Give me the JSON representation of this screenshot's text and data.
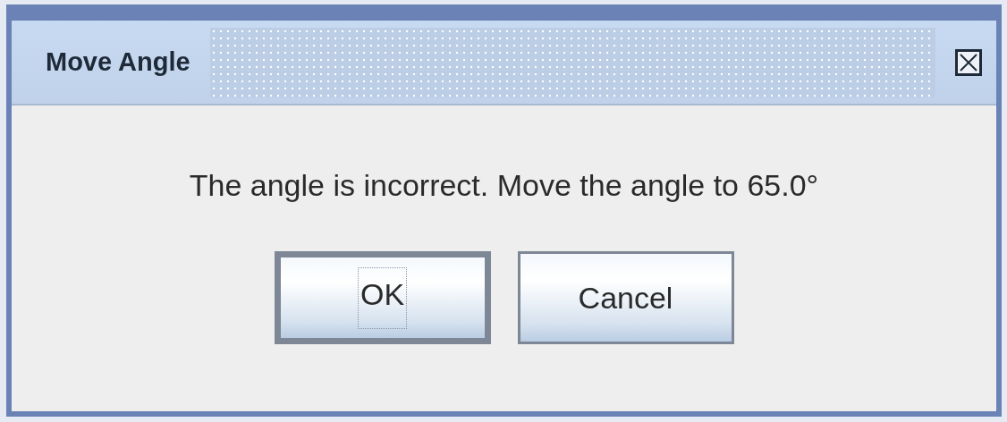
{
  "window": {
    "title": "Move Angle"
  },
  "message": "The angle is incorrect.  Move the angle to 65.0°",
  "buttons": [
    {
      "label": "OK",
      "focused": true
    },
    {
      "label": "Cancel",
      "focused": false
    }
  ]
}
